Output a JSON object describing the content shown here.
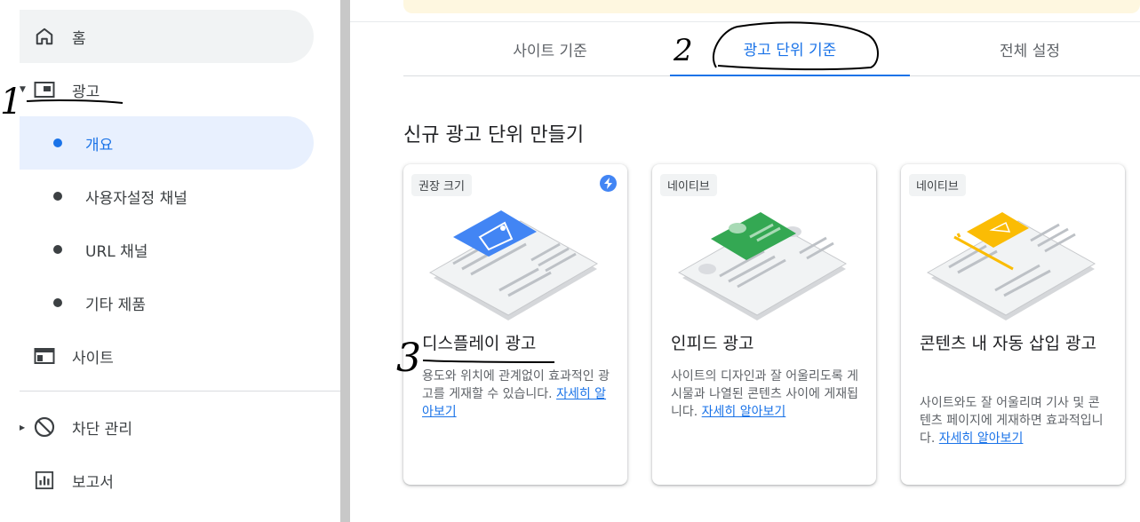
{
  "sidebar": {
    "home": "홈",
    "ads": "광고",
    "ads_sub": [
      "개요",
      "사용자설정 채널",
      "URL 채널",
      "기타 제품"
    ],
    "sites": "사이트",
    "block": "차단 관리",
    "reports": "보고서"
  },
  "tabs": [
    "사이트 기준",
    "광고 단위 기준",
    "전체 설정"
  ],
  "section_title": "신규 광고 단위 만들기",
  "cards": [
    {
      "chip": "권장 크기",
      "title": "디스플레이 광고",
      "desc": "용도와 위치에 관계없이 효과적인 광고를 게재할 수 있습니다.",
      "link": "자세히 알아보기",
      "accent": "#4285f4"
    },
    {
      "chip": "네이티브",
      "title": "인피드 광고",
      "desc": "사이트의 디자인과 잘 어울리도록 게시물과 나열된 콘텐츠 사이에 게재됩니다.",
      "link": "자세히 알아보기",
      "accent": "#34a853"
    },
    {
      "chip": "네이티브",
      "title": "콘텐츠 내 자동 삽입 광고",
      "desc": "사이트와도 잘 어울리며 기사 및 콘텐츠 페이지에 게재하면 효과적입니다.",
      "link": "자세히 알아보기",
      "accent": "#fbbc04"
    }
  ],
  "annotations": [
    "1",
    "2",
    "3"
  ],
  "colors": {
    "accent": "#1a73e8",
    "active_bg": "#e8f0fe"
  }
}
